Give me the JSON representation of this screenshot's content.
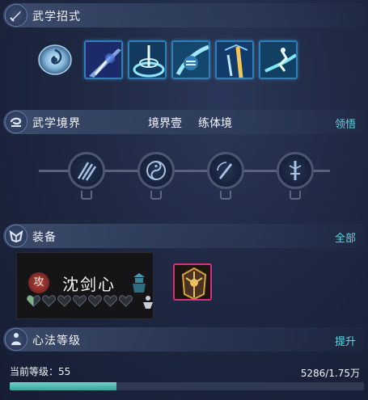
{
  "skills_section": {
    "title": "武学招式",
    "skill_icons": [
      "spiral-talisman-icon",
      "blade-slash-icon",
      "whirlwind-icon",
      "fist-strike-icon",
      "golden-blade-icon",
      "leaping-strike-icon"
    ]
  },
  "realm_section": {
    "title": "武学境界",
    "realm_level": "境界壹",
    "realm_name": "练体境",
    "action_label": "领悟",
    "node_icons": [
      "slash-marks-icon",
      "yin-yang-icon",
      "sword-circle-icon",
      "sword-emblem-icon"
    ]
  },
  "equipment_section": {
    "title": "装备",
    "action_label": "全部",
    "equipped": {
      "badge": "攻",
      "name": "沈剑心",
      "hearts_filled": 0.5,
      "hearts_total": 7
    }
  },
  "cultivation_section": {
    "title": "心法等级",
    "action_label": "提升",
    "level_label": "当前等级：55",
    "exp_text": "5286/1.75万",
    "exp_progress": 0.302
  },
  "colors": {
    "accent_link": "#5ed7e4",
    "exp_fill": "#4fbab0",
    "rare_border": "#d4327f"
  }
}
